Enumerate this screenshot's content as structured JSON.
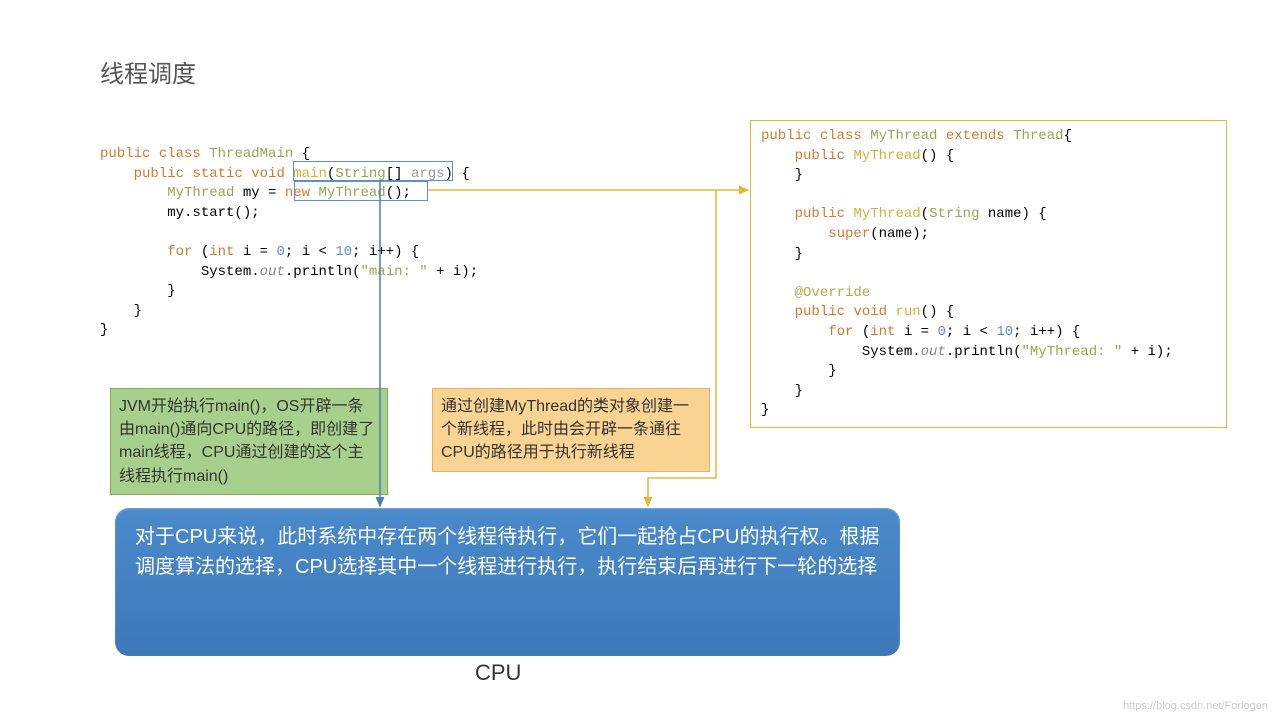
{
  "title": "线程调度",
  "code_left_html": "<span class='kw'>public</span> <span class='kw'>class</span> <span class='cls'>ThreadMain</span> {\n    <span class='kw'>public</span> <span class='kw'>static</span> <span class='kw'>void</span> <span class='mtd'>main</span>(<span class='cls'>String</span>[] <span class='gray'>args</span>) {\n        <span class='cls'>MyThread</span> my = <span class='kw'>new</span> <span class='cls'>MyThread</span>();\n        my.start();\n\n        <span class='kw'>for</span> (<span class='kw'>int</span> i = <span class='num'>0</span>; i &lt; <span class='num'>10</span>; i++) {\n            System.<span class='it'>out</span>.println(<span class='str'>\"main: \"</span> + i);\n        }\n    }\n}",
  "code_right_html": "<span class='kw'>public</span> <span class='kw'>class</span> <span class='cls'>MyThread</span> <span class='kw'>extends</span> <span class='cls'>Thread</span>{\n    <span class='kw'>public</span> <span class='mtd'>MyThread</span>() {\n    }\n\n    <span class='kw'>public</span> <span class='mtd'>MyThread</span>(<span class='cls'>String</span> name) {\n        <span class='kw'>super</span>(name);\n    }\n\n    <span class='ann'>@Override</span>\n    <span class='kw'>public</span> <span class='kw'>void</span> <span class='mtd'>run</span>() {\n        <span class='kw'>for</span> (<span class='kw'>int</span> i = <span class='num'>0</span>; i &lt; <span class='num'>10</span>; i++) {\n            System.<span class='it'>out</span>.println(<span class='str'>\"MyThread: \"</span> + i);\n        }\n    }\n}",
  "green_box": "JVM开始执行main()，OS开辟一条由main()通向CPU的路径，即创建了main线程，CPU通过创建的这个主线程执行main()",
  "orange_box": "通过创建MyThread的类对象创建一个新线程，此时由会开辟一条通往CPU的路径用于执行新线程",
  "blue_panel": "对于CPU来说，此时系统中存在两个线程待执行，它们一起抢占CPU的执行权。根据调度算法的选择，CPU选择其中一个线程进行执行，执行结束后再进行下一轮的选择",
  "cpu_label": "CPU",
  "watermark": "https://blog.csdn.net/Forlogen",
  "colors": {
    "blue_arrow": "#4a7fb5",
    "orange_arrow": "#e6b839",
    "green_box_bg": "#a8d08d",
    "orange_box_bg": "#f9d391",
    "blue_panel_bg": "#4a8acb"
  }
}
